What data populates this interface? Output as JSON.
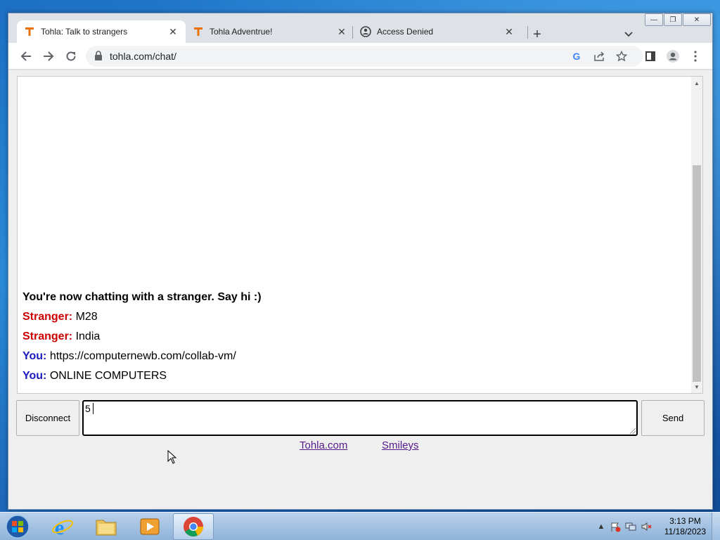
{
  "browser": {
    "tabs": [
      {
        "title": "Tohla: Talk to strangers",
        "active": true,
        "icon": "tohla-favicon"
      },
      {
        "title": "Tohla Adventrue!",
        "active": false,
        "icon": "tohla-favicon"
      },
      {
        "title": "Access Denied",
        "active": false,
        "icon": "access-denied-favicon"
      }
    ],
    "url": "tohla.com/chat/"
  },
  "chat": {
    "system_message": "You're now chatting with a stranger. Say hi :)",
    "messages": [
      {
        "speaker": "Stranger:",
        "text": "M28",
        "role": "stranger"
      },
      {
        "speaker": "Stranger:",
        "text": "India",
        "role": "stranger"
      },
      {
        "speaker": "You:",
        "text": "https://computernewb.com/collab-vm/",
        "role": "you"
      },
      {
        "speaker": "You:",
        "text": "ONLINE COMPUTERS",
        "role": "you"
      }
    ],
    "input_value": "5",
    "disconnect_label": "Disconnect",
    "send_label": "Send"
  },
  "footer_links": {
    "tohla": "Tohla.com",
    "smileys": "Smileys"
  },
  "taskbar": {
    "time": "3:13 PM",
    "date": "11/18/2023"
  },
  "colors": {
    "stranger": "#cc0000",
    "you": "#1a1ac0",
    "tohla_brand": "#e8710a"
  }
}
